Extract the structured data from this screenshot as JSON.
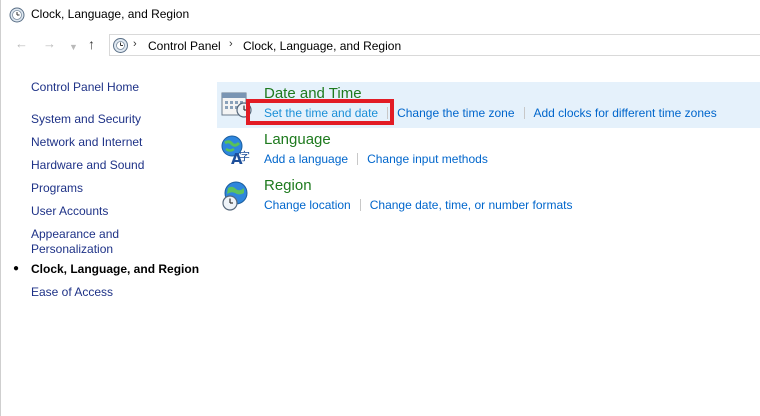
{
  "window": {
    "title": "Clock, Language, and Region"
  },
  "navigation": {
    "back_icon": "back-arrow-icon",
    "forward_icon": "forward-arrow-icon",
    "recent_icon": "chevron-down-icon",
    "up_icon": "up-arrow-icon"
  },
  "address": {
    "separator": "›",
    "breadcrumbs": [
      "Control Panel",
      "Clock, Language, and Region"
    ]
  },
  "sidebar": {
    "home": "Control Panel Home",
    "items": [
      {
        "label": "System and Security"
      },
      {
        "label": "Network and Internet"
      },
      {
        "label": "Hardware and Sound"
      },
      {
        "label": "Programs"
      },
      {
        "label": "User Accounts"
      },
      {
        "label": "Appearance and",
        "label2": "Personalization"
      },
      {
        "label": "Clock, Language, and Region",
        "current": true
      },
      {
        "label": "Ease of Access"
      }
    ],
    "bullet": "●"
  },
  "categories": [
    {
      "title": "Date and Time",
      "icon": "calendar-clock-icon",
      "links": [
        "Set the time and date",
        "Change the time zone",
        "Add clocks for different time zones"
      ]
    },
    {
      "title": "Language",
      "icon": "language-icon",
      "links": [
        "Add a language",
        "Change input methods"
      ]
    },
    {
      "title": "Region",
      "icon": "globe-clock-icon",
      "links": [
        "Change location",
        "Change date, time, or number formats"
      ]
    }
  ],
  "colors": {
    "link": "#0066cc",
    "category_title": "#1e7a1e",
    "highlight": "#e5f1fb",
    "annotation": "#e21c25"
  }
}
